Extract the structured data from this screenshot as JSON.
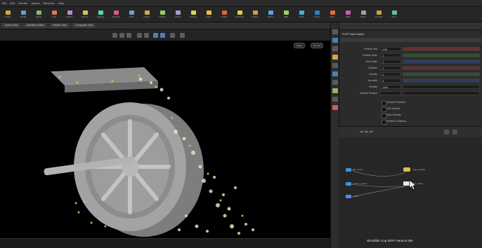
{
  "menu": {
    "items": [
      "File",
      "Edit",
      "Render",
      "Assets",
      "Windows",
      "Help"
    ]
  },
  "shelf": {
    "tools": [
      {
        "label": "Create",
        "color": "#d8a63a"
      },
      {
        "label": "Modify",
        "color": "#5aa0d8"
      },
      {
        "label": "Model",
        "color": "#8fb86a"
      },
      {
        "label": "Poly",
        "color": "#d87a5a"
      },
      {
        "label": "Deform",
        "color": "#b58fd8"
      },
      {
        "label": "Texture",
        "color": "#d8c35a"
      },
      {
        "label": "Rigging",
        "color": "#5ad8b8"
      },
      {
        "label": "Muscles",
        "color": "#d85a8a"
      },
      {
        "label": "Char",
        "color": "#7a9ad8"
      },
      {
        "label": "Guides",
        "color": "#d8a65a"
      },
      {
        "label": "Terrain",
        "color": "#8ad85a"
      },
      {
        "label": "Cloud",
        "color": "#a0a0d8"
      },
      {
        "label": "Volume",
        "color": "#d8d85a"
      },
      {
        "label": "Lights",
        "color": "#f0c040"
      },
      {
        "label": "Collide",
        "color": "#d86a3a"
      },
      {
        "label": "Particles",
        "color": "#e0d040"
      },
      {
        "label": "Grains",
        "color": "#c0a060"
      },
      {
        "label": "Vellum",
        "color": "#60a0e0"
      },
      {
        "label": "RBD",
        "color": "#a0d060"
      },
      {
        "label": "Fluid",
        "color": "#40b0e0"
      },
      {
        "label": "Ocean",
        "color": "#3080c0"
      },
      {
        "label": "Pyro",
        "color": "#e07030"
      },
      {
        "label": "FEM",
        "color": "#c060c0"
      },
      {
        "label": "Wires",
        "color": "#a0a0a0"
      },
      {
        "label": "Crowds",
        "color": "#d0a040"
      },
      {
        "label": "Drive",
        "color": "#60c0a0"
      }
    ]
  },
  "tabs": [
    "Scene View",
    "Animation Editor",
    "Render View",
    "Composite View"
  ],
  "viewport": {
    "btn_persp": "Persp",
    "btn_cam": "No cam"
  },
  "status": {
    "text": ""
  },
  "params": {
    "header": "FLIP Fluid Object",
    "rows": [
      {
        "label": "Particle Sep",
        "value": "0.05"
      },
      {
        "label": "Radius Scale",
        "value": "2"
      },
      {
        "label": "Grid Scale",
        "value": "2"
      },
      {
        "label": "Collision",
        "value": "0"
      },
      {
        "label": "Velocity",
        "value": "0"
      },
      {
        "label": "Viscosity",
        "value": "0"
      },
      {
        "label": "Density",
        "value": "1000"
      },
      {
        "label": "Surface Tension",
        "value": ""
      }
    ],
    "checks": [
      "Reseed Particles",
      "Kill Outside",
      "Add Vorticity",
      "Enable Collisions"
    ]
  },
  "network": {
    "path": "obj / flip_sim",
    "nodes": [
      {
        "label": "flip_source",
        "color": "#4a90d9"
      },
      {
        "label": "volume_source",
        "color": "#4a90d9"
      },
      {
        "label": "dop_network",
        "color": "#d8c040"
      },
      {
        "label": "flip_solver",
        "color": "#4a90d9"
      },
      {
        "label": "output",
        "color": "#4a90d9"
      }
    ]
  },
  "watermark": "Wimdifair Cop IDOF Haranio ntle"
}
